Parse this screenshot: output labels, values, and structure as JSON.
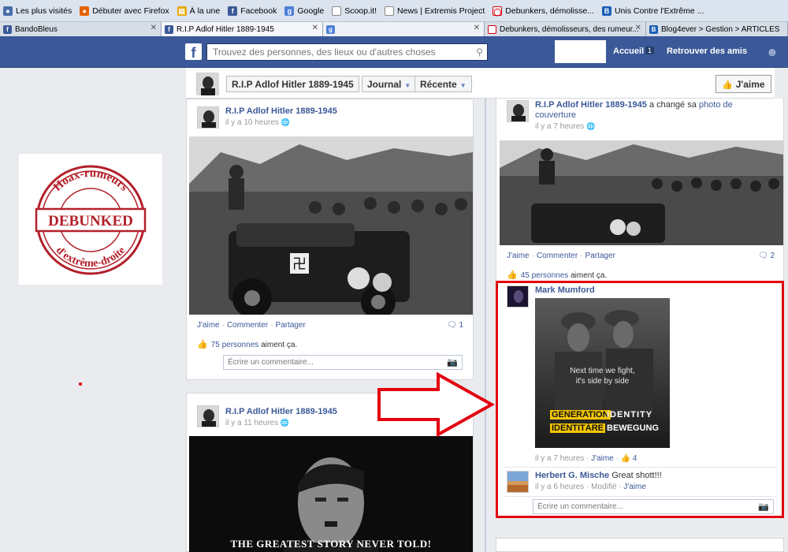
{
  "bookmarks": [
    {
      "label": "Les plus visités",
      "icon": "firefox-icon",
      "color": "#4a6ea9"
    },
    {
      "label": "Débuter avec Firefox",
      "icon": "firefox-icon",
      "color": "#e66000"
    },
    {
      "label": "À la une",
      "icon": "rss-icon",
      "color": "#e8a800"
    },
    {
      "label": "Facebook",
      "icon": "facebook-icon",
      "color": "#3b5998"
    },
    {
      "label": "Google",
      "icon": "google-icon",
      "color": "#4d7fd8"
    },
    {
      "label": "Scoop.it!",
      "icon": "page-icon",
      "color": "#ffffff"
    },
    {
      "label": "News | Extremis Project",
      "icon": "page-icon",
      "color": "#ffffff"
    },
    {
      "label": "Debunkers, démolisse...",
      "icon": "debunkers-icon",
      "color": "#d8000c"
    },
    {
      "label": "Unis Contre l'Extrême ...",
      "icon": "blog-icon",
      "color": "#1b5fb5"
    }
  ],
  "tabs": [
    {
      "label": "BandoBleus",
      "icon": "facebook-icon",
      "active": false
    },
    {
      "label": "R.I.P Adlof Hitler 1889-1945",
      "icon": "facebook-icon",
      "active": true
    },
    {
      "label": "",
      "icon": "google-icon",
      "active": false
    },
    {
      "label": "Debunkers, démolisseurs, des rumeur...",
      "icon": "debunkers-icon",
      "active": false
    },
    {
      "label": "Blog4ever > Gestion > ARTICLES",
      "icon": "blog-icon",
      "active": false
    }
  ],
  "fb": {
    "search_placeholder": "Trouvez des personnes, des lieux ou d'autres choses",
    "home": "Accueil",
    "home_badge": "1",
    "find_friends": "Retrouver des amis"
  },
  "stamp": {
    "top": "Hoax-rumeurs",
    "middle": "DEBUNKED",
    "bottom": "d'extrême-droite"
  },
  "page_header": {
    "title": "R.I.P Adlof Hitler 1889-1945",
    "journal": "Journal",
    "recente": "Récente",
    "like_button": "J'aime"
  },
  "posts": {
    "left1": {
      "author": "R.I.P Adlof Hitler 1889-1945",
      "time": "il y a 10 heures",
      "like": "J'aime",
      "comment": "Commenter",
      "share": "Partager",
      "comment_count": "1",
      "likes_count": "75 personnes",
      "likes_suffix": "aiment ça.",
      "comment_placeholder": "Écrire un commentaire..."
    },
    "left2": {
      "author": "R.I.P Adlof Hitler 1889-1945",
      "time": "il y a 11 heures",
      "photo_caption": "THE GREATEST STORY NEVER TOLD!"
    },
    "right1": {
      "author": "R.I.P Adlof Hitler 1889-1945",
      "action": "a changé sa",
      "action_link": "photo de couverture",
      "time": "il y a 7 heures",
      "like": "J'aime",
      "comment": "Commenter",
      "share": "Partager",
      "comment_count": "2",
      "likes_count": "45 personnes",
      "likes_suffix": "aiment ça."
    }
  },
  "comments": {
    "c1": {
      "author": "Mark Mumford",
      "image_line1": "Next time we fight,",
      "image_line2": "it's side by side",
      "image_gen": "GENERATION",
      "image_identity": "IDENTITY",
      "image_identitaire": "IDENTITÄRE",
      "image_bewegung": "BEWEGUNG",
      "time": "il y a 7 heures",
      "like": "J'aime",
      "likes": "4"
    },
    "c2": {
      "author": "Herbert G. Mische",
      "text": "Great shott!!!",
      "time": "il y a 6 heures",
      "edited": "Modifié",
      "like": "J'aime"
    },
    "write_placeholder": "Écrire un commentaire..."
  },
  "colors": {
    "fb_blue": "#3b5998",
    "highlight_red": "#e3000f",
    "stamp_red": "#b3202a"
  }
}
